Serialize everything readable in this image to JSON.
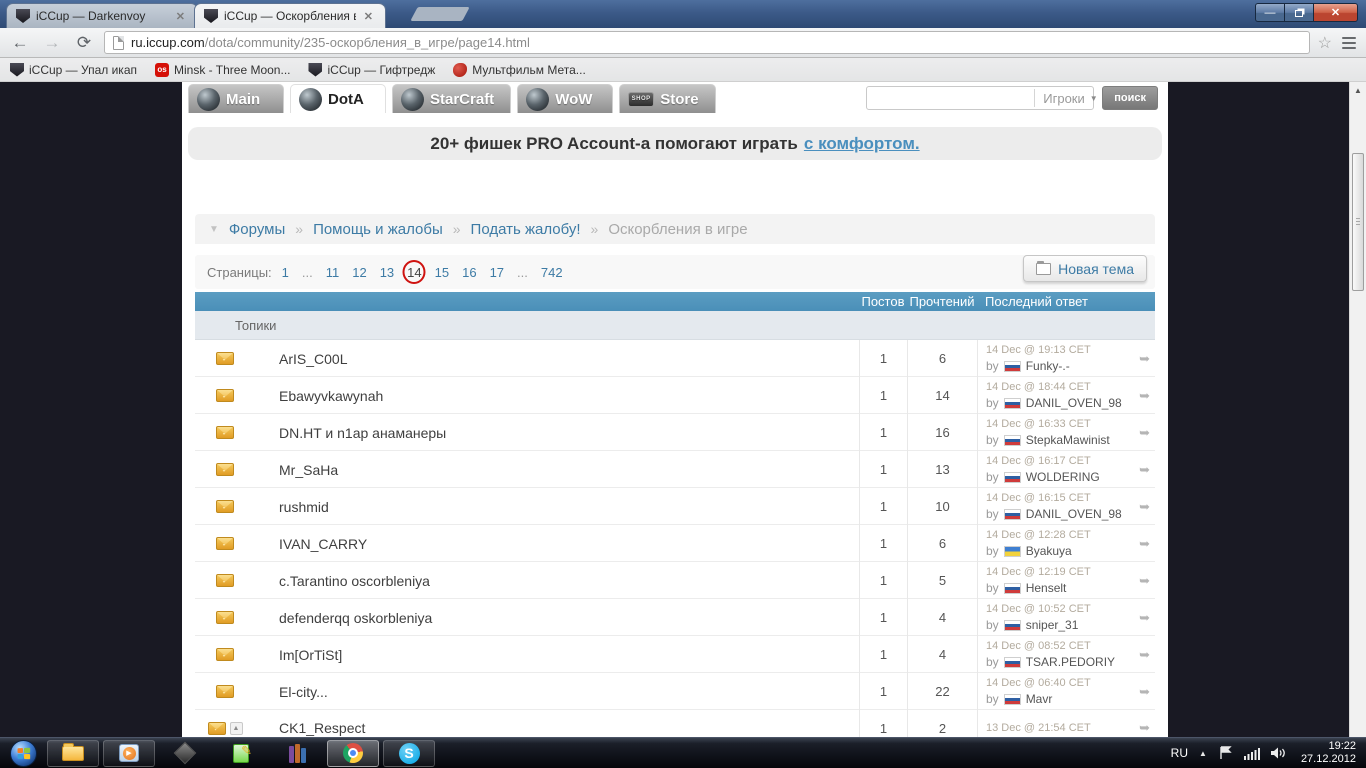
{
  "browser": {
    "tabs": [
      {
        "title": "iCCup — Darkenvoy",
        "active": false
      },
      {
        "title": "iCCup — Оскорбления в",
        "active": true
      }
    ],
    "url_host": "ru.iccup.com",
    "url_path": "/dota/community/235-оскорбления_в_игре/page14.html",
    "bookmarks": [
      {
        "label": "iCCup — Упал икап",
        "icon": "iccup"
      },
      {
        "label": "Minsk - Three Moon...",
        "icon": "os",
        "icon_text": "os"
      },
      {
        "label": "iCCup — Гифтредж",
        "icon": "iccup"
      },
      {
        "label": "Мультфильм Мета...",
        "icon": "red"
      }
    ]
  },
  "site": {
    "nav_tabs": [
      {
        "label": "Main",
        "icon": "trophy-icon",
        "active": false
      },
      {
        "label": "DotA",
        "icon": "dota-icon",
        "active": true
      },
      {
        "label": "StarCraft",
        "icon": "starcraft-icon",
        "active": false
      },
      {
        "label": "WoW",
        "icon": "wow-icon",
        "active": false
      },
      {
        "label": "Store",
        "icon": "shop-icon",
        "shop": true,
        "active": false
      }
    ],
    "search": {
      "category": "Игроки",
      "button": "поиск"
    },
    "banner": {
      "text": "20+ фишек PRO Account-а помогают играть",
      "link": "с комфортом."
    },
    "breadcrumbs": [
      {
        "label": "Форумы"
      },
      {
        "label": "Помощь и жалобы"
      },
      {
        "label": "Подать жалобу!"
      },
      {
        "label": "Оскорбления в игре",
        "current": true
      }
    ],
    "pagination": {
      "label": "Страницы:",
      "pages": [
        {
          "label": "1"
        },
        {
          "label": "...",
          "ellipsis": true
        },
        {
          "label": "11"
        },
        {
          "label": "12"
        },
        {
          "label": "13"
        },
        {
          "label": "14",
          "current": true
        },
        {
          "label": "15"
        },
        {
          "label": "16"
        },
        {
          "label": "17"
        },
        {
          "label": "...",
          "ellipsis": true
        },
        {
          "label": "742"
        }
      ]
    },
    "new_topic_button": "Новая тема",
    "table": {
      "headers": {
        "posts": "Постов",
        "reads": "Прочтений",
        "last": "Последний ответ"
      },
      "section": "Топики",
      "by_label": "by",
      "rows": [
        {
          "title": "ArIS_C00L",
          "posts": "1",
          "reads": "6",
          "date": "14 Dec @ 19:13 CET",
          "by": "by",
          "user": "Funky-.-",
          "flag": "ru"
        },
        {
          "title": "Ebawyvkawynah",
          "posts": "1",
          "reads": "14",
          "date": "14 Dec @ 18:44 CET",
          "by": "by",
          "user": "DANIL_OVEN_98",
          "flag": "ru"
        },
        {
          "title": "DN.HT и n1ap анаманеры",
          "posts": "1",
          "reads": "16",
          "date": "14 Dec @ 16:33 CET",
          "by": "by",
          "user": "StepkaMawinist",
          "flag": "ru"
        },
        {
          "title": "Mr_SaHa",
          "posts": "1",
          "reads": "13",
          "date": "14 Dec @ 16:17 CET",
          "by": "by",
          "user": "WOLDERING",
          "flag": "ru"
        },
        {
          "title": "rushmid",
          "posts": "1",
          "reads": "10",
          "date": "14 Dec @ 16:15 CET",
          "by": "by",
          "user": "DANIL_OVEN_98",
          "flag": "ru"
        },
        {
          "title": "IVAN_CARRY",
          "posts": "1",
          "reads": "6",
          "date": "14 Dec @ 12:28 CET",
          "by": "by",
          "user": "Byakuya",
          "flag": "ua"
        },
        {
          "title": "c.Tarantino oscorbleniya",
          "posts": "1",
          "reads": "5",
          "date": "14 Dec @ 12:19 CET",
          "by": "by",
          "user": "Henselt",
          "flag": "ru"
        },
        {
          "title": "defenderqq oskorbleniya",
          "posts": "1",
          "reads": "4",
          "date": "14 Dec @ 10:52 CET",
          "by": "by",
          "user": "sniper_31",
          "flag": "ru"
        },
        {
          "title": "Im[OrTiSt]",
          "posts": "1",
          "reads": "4",
          "date": "14 Dec @ 08:52 CET",
          "by": "by",
          "user": "TSAR.PEDORIY",
          "flag": "ru"
        },
        {
          "title": "El-city...",
          "posts": "1",
          "reads": "22",
          "date": "14 Dec @ 06:40 CET",
          "by": "by",
          "user": "Mavr",
          "flag": "ru"
        },
        {
          "title": "CK1_Respect",
          "posts": "1",
          "reads": "2",
          "date": "13 Dec @ 21:54 CET",
          "by": "",
          "user": "",
          "flag": "",
          "extra_icon": true
        }
      ]
    }
  },
  "taskbar": {
    "icons": [
      "start",
      "explorer",
      "media-player",
      "iccup-launcher",
      "notepad-plus",
      "winrar",
      "chrome",
      "skype"
    ],
    "tray": {
      "lang": "RU",
      "time": "19:22",
      "date": "27.12.2012"
    }
  }
}
